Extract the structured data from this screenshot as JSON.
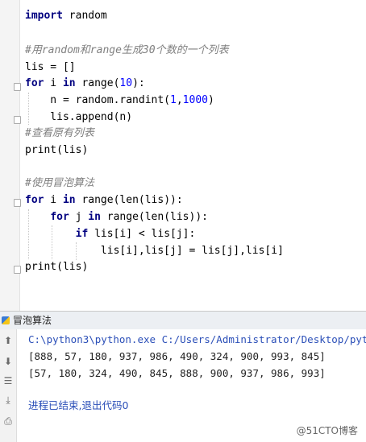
{
  "editor": {
    "lines": {
      "l1": {
        "kw": "import",
        "rest": " random"
      },
      "l3": {
        "comment": "#用random和range生成30个数的一个列表"
      },
      "l4": {
        "text": "lis = []"
      },
      "l5": {
        "kw": "for",
        "a": " i ",
        "kw2": "in",
        "b": " range(",
        "num": "10",
        "c": "):"
      },
      "l6": {
        "a": "    n = random.randint(",
        "num1": "1",
        "b": ",",
        "num2": "1000",
        "c": ")"
      },
      "l7": {
        "text": "    lis.append(n)"
      },
      "l8": {
        "comment": "#查看原有列表"
      },
      "l9": {
        "text": "print(lis)"
      },
      "l11": {
        "comment": "#使用冒泡算法"
      },
      "l12": {
        "kw": "for",
        "a": " i ",
        "kw2": "in",
        "b": " range(len(lis)):"
      },
      "l13": {
        "indent": "    ",
        "kw": "for",
        "a": " j ",
        "kw2": "in",
        "b": " range(len(lis)):"
      },
      "l14": {
        "indent": "        ",
        "kw": "if",
        "b": " lis[i] < lis[j]:"
      },
      "l15": {
        "text": "            lis[i],lis[j] = lis[j],lis[i]"
      },
      "l16": {
        "text": "print(lis)"
      }
    }
  },
  "run_panel": {
    "title": "冒泡算法",
    "command": "C:\\python3\\python.exe C:/Users/Administrator/Desktop/pytho",
    "output_1": "[888, 57, 180, 937, 986, 490, 324, 900, 993, 845]",
    "output_2": "[57, 180, 324, 490, 845, 888, 900, 937, 986, 993]",
    "exit_message": "进程已结束,退出代码0"
  },
  "watermark": "@51CTO博客",
  "icons": [
    "python-file-icon",
    "rerun-up-icon",
    "rerun-down-icon",
    "soft-wrap-icon",
    "scroll-to-end-icon",
    "print-icon"
  ]
}
